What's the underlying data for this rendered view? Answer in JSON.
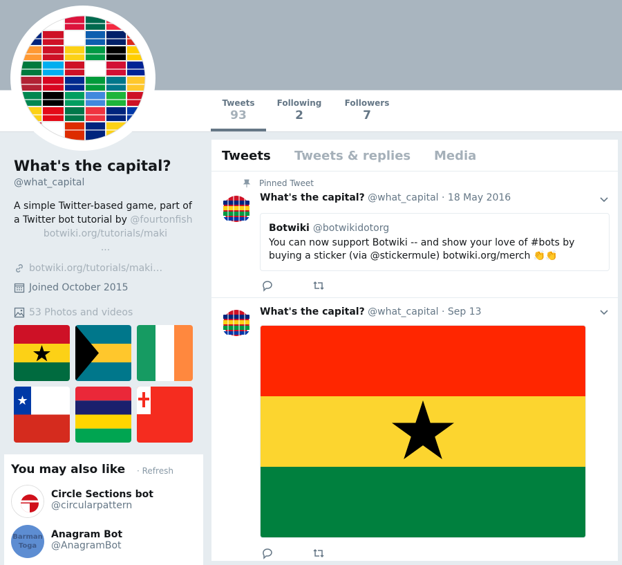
{
  "profile": {
    "name": "What's the capital?",
    "handle": "@what_capital",
    "bio_text": "A simple Twitter-based game, part of a Twitter bot tutorial by",
    "bio_mention": "@fourtonfish",
    "bio_link": "botwiki.org/tutorials/maki",
    "bio_ellipsis": "...",
    "website": "botwiki.org/tutorials/maki…",
    "joined": "Joined October 2015",
    "photos_label": "53 Photos and videos"
  },
  "stats": {
    "tweets_label": "Tweets",
    "tweets_count": "93",
    "following_label": "Following",
    "following_count": "2",
    "followers_label": "Followers",
    "followers_count": "7"
  },
  "timeline_tabs": {
    "tweets": "Tweets",
    "replies": "Tweets & replies",
    "media": "Media"
  },
  "tweets": [
    {
      "pinned_label": "Pinned Tweet",
      "name": "What's the capital?",
      "handle_date": "@what_capital · 18 May 2016",
      "quote": {
        "name": "Botwiki",
        "handle": "@botwikidotorg",
        "text": "You can now support Botwiki -- and show your love of #bots by buying a sticker (via @stickermule)         botwiki.org/merch 👏👏"
      }
    },
    {
      "name": "What's the capital?",
      "handle_date": "@what_capital · Sep 13"
    }
  ],
  "who_to_follow": {
    "title": "You may also like",
    "refresh": "· Refresh",
    "users": [
      {
        "name": "Circle Sections bot",
        "handle": "@circularpattern"
      },
      {
        "name": "Anagram Bot",
        "handle": "@AnagramBot",
        "avatar_text_top": "Barman",
        "avatar_text_bottom": "Toga"
      }
    ]
  },
  "icons": {
    "link": "link-icon",
    "calendar": "calendar-icon",
    "photo": "photo-icon",
    "pin": "pin-icon",
    "chevron": "chevron-down-icon",
    "reply": "reply-icon",
    "retweet": "retweet-icon",
    "like": "heart-icon"
  },
  "colors": {
    "accent_gray": "#657786",
    "light_gray": "#a5b0b9",
    "banner": "#a9b5bf"
  }
}
